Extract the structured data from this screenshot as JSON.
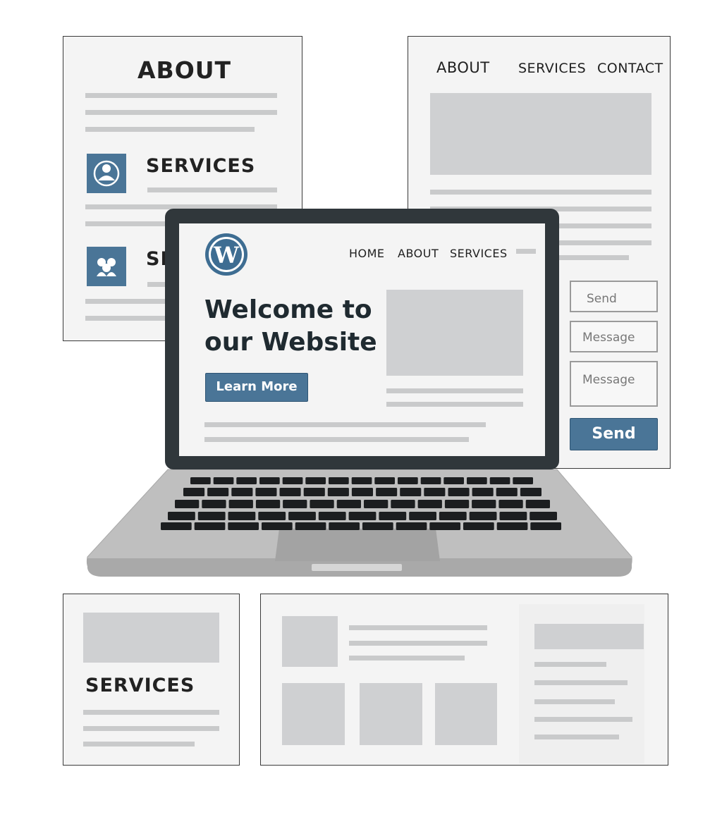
{
  "about_card": {
    "heading": "ABOUT",
    "services_heading_1": "SERVICES",
    "services_heading_2_partial": "SE"
  },
  "nav_card": {
    "nav": [
      "ABOUT",
      "SERVICES",
      "CONTACT"
    ]
  },
  "contact_form": {
    "field_1": "Send",
    "field_2": "Message",
    "field_3": "Message",
    "submit_label": "Send"
  },
  "laptop_site": {
    "nav": [
      "HOME",
      "ABOUT",
      "SERVICES"
    ],
    "hero_line_1": "Welcome to",
    "hero_line_2": "our Website",
    "cta_label": "Learn More",
    "logo": "wordpress-logo",
    "accent_color": "#4a7597"
  },
  "services_card": {
    "heading": "SERVICES"
  }
}
